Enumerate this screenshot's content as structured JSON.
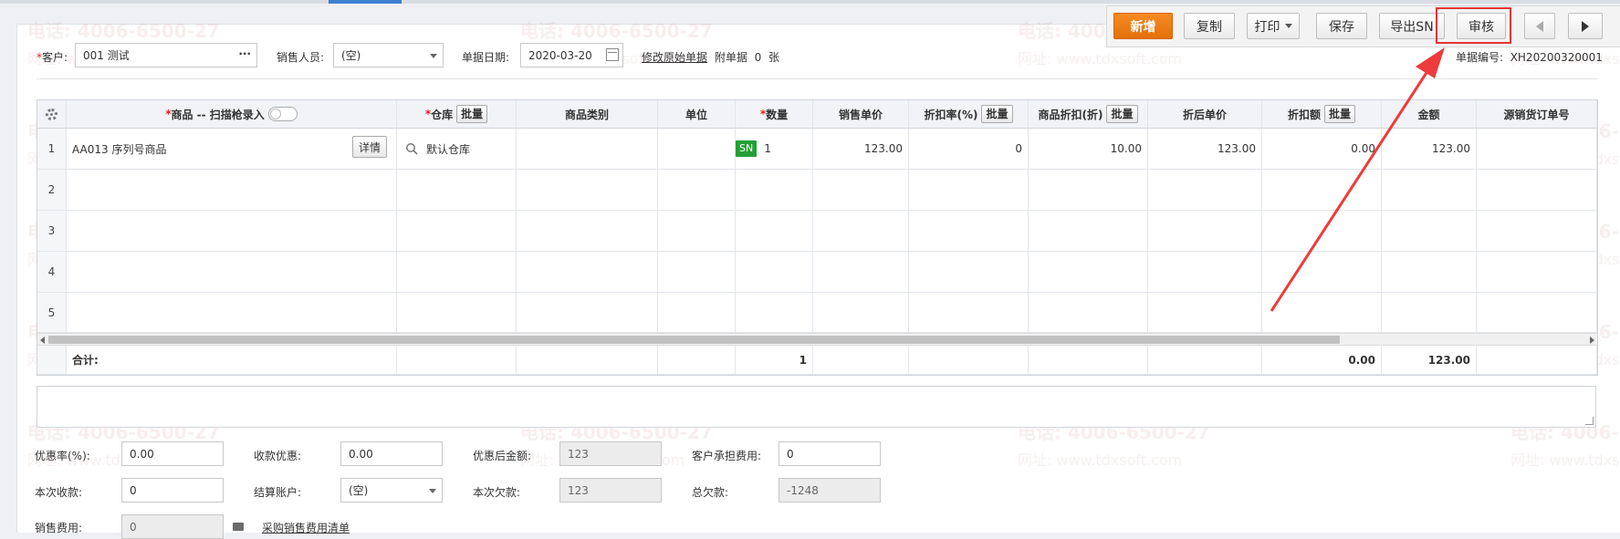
{
  "toolbar": {
    "new_label": "新增",
    "copy_label": "复制",
    "print_label": "打印",
    "save_label": "保存",
    "export_sn_label": "导出SN",
    "audit_label": "审核"
  },
  "header": {
    "customer_label": "客户:",
    "customer_value": "001 测试",
    "salesperson_label": "销售人员:",
    "salesperson_value": "(空)",
    "date_label": "单据日期:",
    "date_value": "2020-03-20",
    "modify_link": "修改原始单据",
    "attachment_label": "附单据",
    "attachment_count": "0",
    "attachment_unit": "张",
    "doc_no_label": "单据编号:",
    "doc_no_value": "XH20200320001"
  },
  "grid": {
    "columns": {
      "product": "商品 -- 扫描枪录入",
      "warehouse": "仓库",
      "category": "商品类别",
      "unit": "单位",
      "qty": "数量",
      "price": "销售单价",
      "discount_rate": "折扣率(%)",
      "product_discount": "商品折扣(折)",
      "disc_price": "折后单价",
      "disc_amount": "折扣额",
      "amount": "金额",
      "source_no": "源销货订单号"
    },
    "batch_label": "批量",
    "detail_label": "详情",
    "row_numbers": [
      "1",
      "2",
      "3",
      "4",
      "5"
    ],
    "rows": [
      {
        "product": "AA013 序列号商品",
        "warehouse": "默认仓库",
        "sn_badge": "SN",
        "qty": "1",
        "price": "123.00",
        "discount_rate": "0",
        "product_discount": "10.00",
        "disc_price": "123.00",
        "disc_amount": "0.00",
        "amount": "123.00"
      }
    ],
    "total_label": "合计:",
    "total_qty": "1",
    "total_disc_amount": "0.00",
    "total_amount": "123.00"
  },
  "footer": {
    "discount_rate_label": "优惠率(%):",
    "discount_rate_value": "0.00",
    "collect_discount_label": "收款优惠:",
    "collect_discount_value": "0.00",
    "after_discount_label": "优惠后金额:",
    "after_discount_value": "123",
    "customer_fee_label": "客户承担费用:",
    "customer_fee_value": "0",
    "this_receipt_label": "本次收款:",
    "this_receipt_value": "0",
    "settle_account_label": "结算账户:",
    "settle_account_value": "(空)",
    "this_owed_label": "本次欠款:",
    "this_owed_value": "123",
    "total_owed_label": "总欠款:",
    "total_owed_value": "-1248",
    "sales_fee_label": "销售费用:",
    "sales_fee_value": "0",
    "purchase_fee_link": "采购销售费用清单"
  },
  "watermark": {
    "phone": "电话: 4006-6500-27",
    "site": "网址: www.tdxsoft.com"
  },
  "colors": {
    "primary_button": "#f07d15",
    "highlight_box": "#e33535",
    "sn_badge": "#23a035"
  }
}
